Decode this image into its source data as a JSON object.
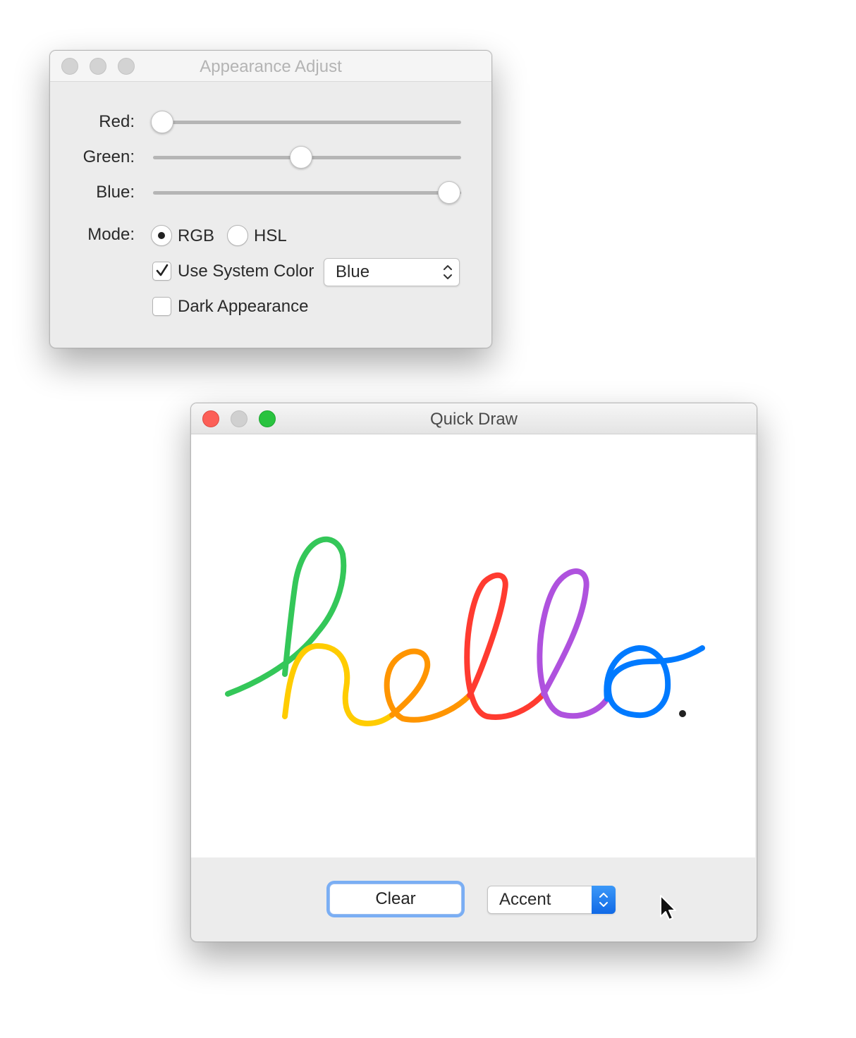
{
  "appearance_window": {
    "title": "Appearance Adjust",
    "sliders": [
      {
        "label": "Red:",
        "value": 0.03
      },
      {
        "label": "Green:",
        "value": 0.48
      },
      {
        "label": "Blue:",
        "value": 0.96
      }
    ],
    "mode": {
      "label": "Mode:",
      "options": [
        {
          "label": "RGB",
          "selected": true
        },
        {
          "label": "HSL",
          "selected": false
        }
      ]
    },
    "use_system_color": {
      "label": "Use System Color",
      "checked": true
    },
    "system_color_popup": {
      "value": "Blue"
    },
    "dark_appearance": {
      "label": "Dark Appearance",
      "checked": false
    }
  },
  "quickdraw_window": {
    "title": "Quick Draw",
    "drawing": {
      "content": "hello.",
      "colors": [
        "#34c759",
        "#ffcc00",
        "#ff9500",
        "#ff3b30",
        "#af52de",
        "#007aff",
        "#222222"
      ]
    },
    "clear_button": "Clear",
    "color_popup": {
      "value": "Accent"
    }
  },
  "icons": {
    "close": "close-icon",
    "minimize": "minimize-icon",
    "zoom": "zoom-icon",
    "checkmark": "checkmark-icon",
    "popup_chevrons": "up-down-chevron-icon",
    "cursor": "mouse-pointer-icon"
  },
  "colors": {
    "traffic_close": "#fc5f57",
    "traffic_zoom": "#29c33f",
    "focus_ring": "#7aaef4",
    "popup_accent": "#1a73e8"
  }
}
